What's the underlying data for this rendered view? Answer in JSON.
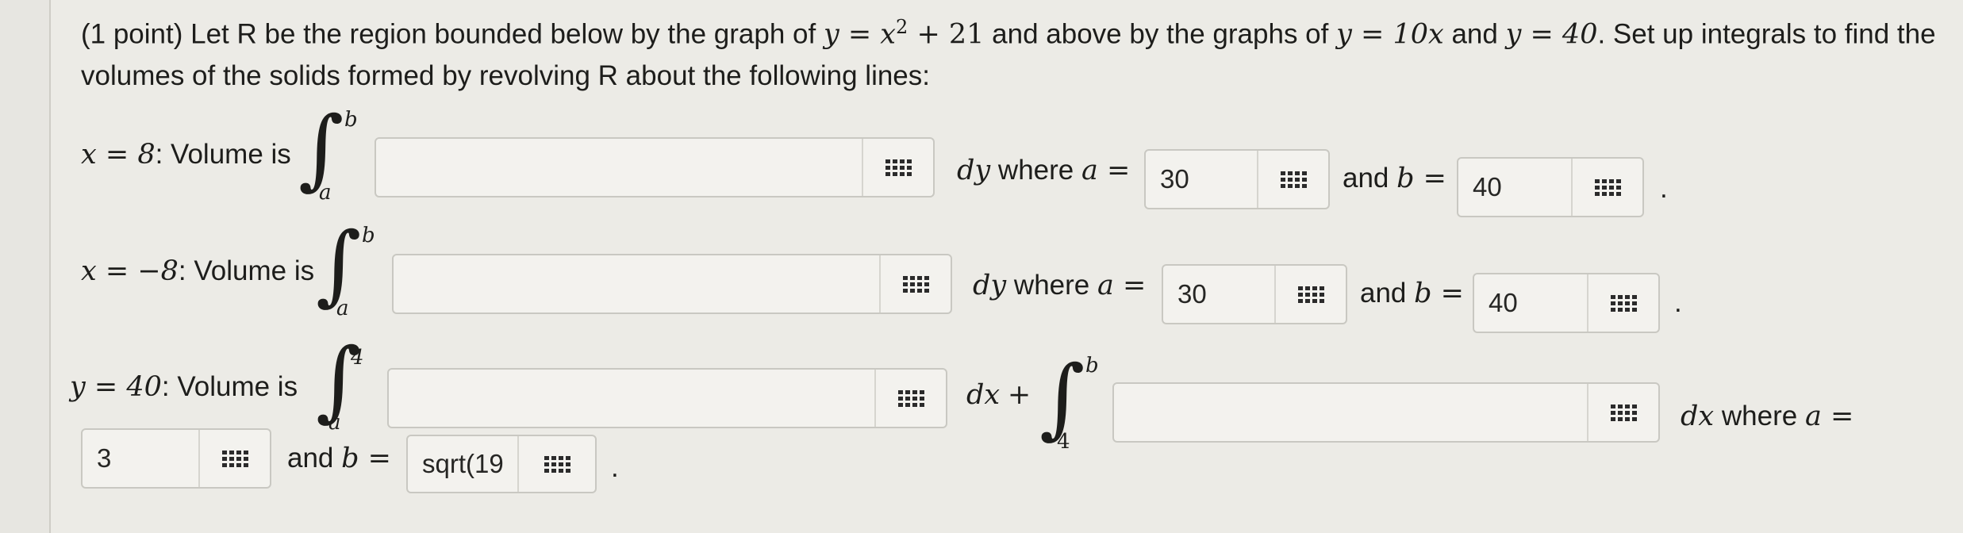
{
  "problem": {
    "intro_before_eq": "(1 point) Let R be the region bounded below by the graph of ",
    "eq1": "y = x",
    "eq1_exp": "2",
    "eq1_tail": " + 21",
    "mid1": " and above by the graphs of ",
    "eq2": "y = 10x",
    "mid2": " and ",
    "eq3": "y = 40",
    "end": ". Set up integrals to find the volumes of the solids formed by revolving R about the following lines:"
  },
  "rows": [
    {
      "label_math": "x = 8",
      "label_text": ": Volume is",
      "integral_upper": "b",
      "integral_lower": "a",
      "integrand_value": "",
      "differential": "dy",
      "where_text": "where",
      "a_label": "a =",
      "a_value": "30",
      "and_text": "and",
      "b_label": "b =",
      "b_value": "40",
      "period": "."
    },
    {
      "label_math": "x = −8",
      "label_text": ": Volume is",
      "integral_upper": "b",
      "integral_lower": "a",
      "integrand_value": "",
      "differential": "dy",
      "where_text": "where",
      "a_label": "a =",
      "a_value": "30",
      "and_text": "and",
      "b_label": "b =",
      "b_value": "40",
      "period": "."
    },
    {
      "label_math": "y = 40",
      "label_text": ": Volume is",
      "integral1_upper": "4",
      "integral1_lower": "a",
      "integrand1_value": "",
      "differential1": "dx",
      "plus": "+",
      "integral2_upper": "b",
      "integral2_lower": "4",
      "integrand2_value": "",
      "differential2": "dx",
      "where_text": "where",
      "a_label": "a =",
      "a_value": "3",
      "and_text": "and",
      "b_label": "b =",
      "b_value": "sqrt(19",
      "period": "."
    }
  ],
  "icons": {
    "keyboard": "equation-editor-grid-icon"
  }
}
